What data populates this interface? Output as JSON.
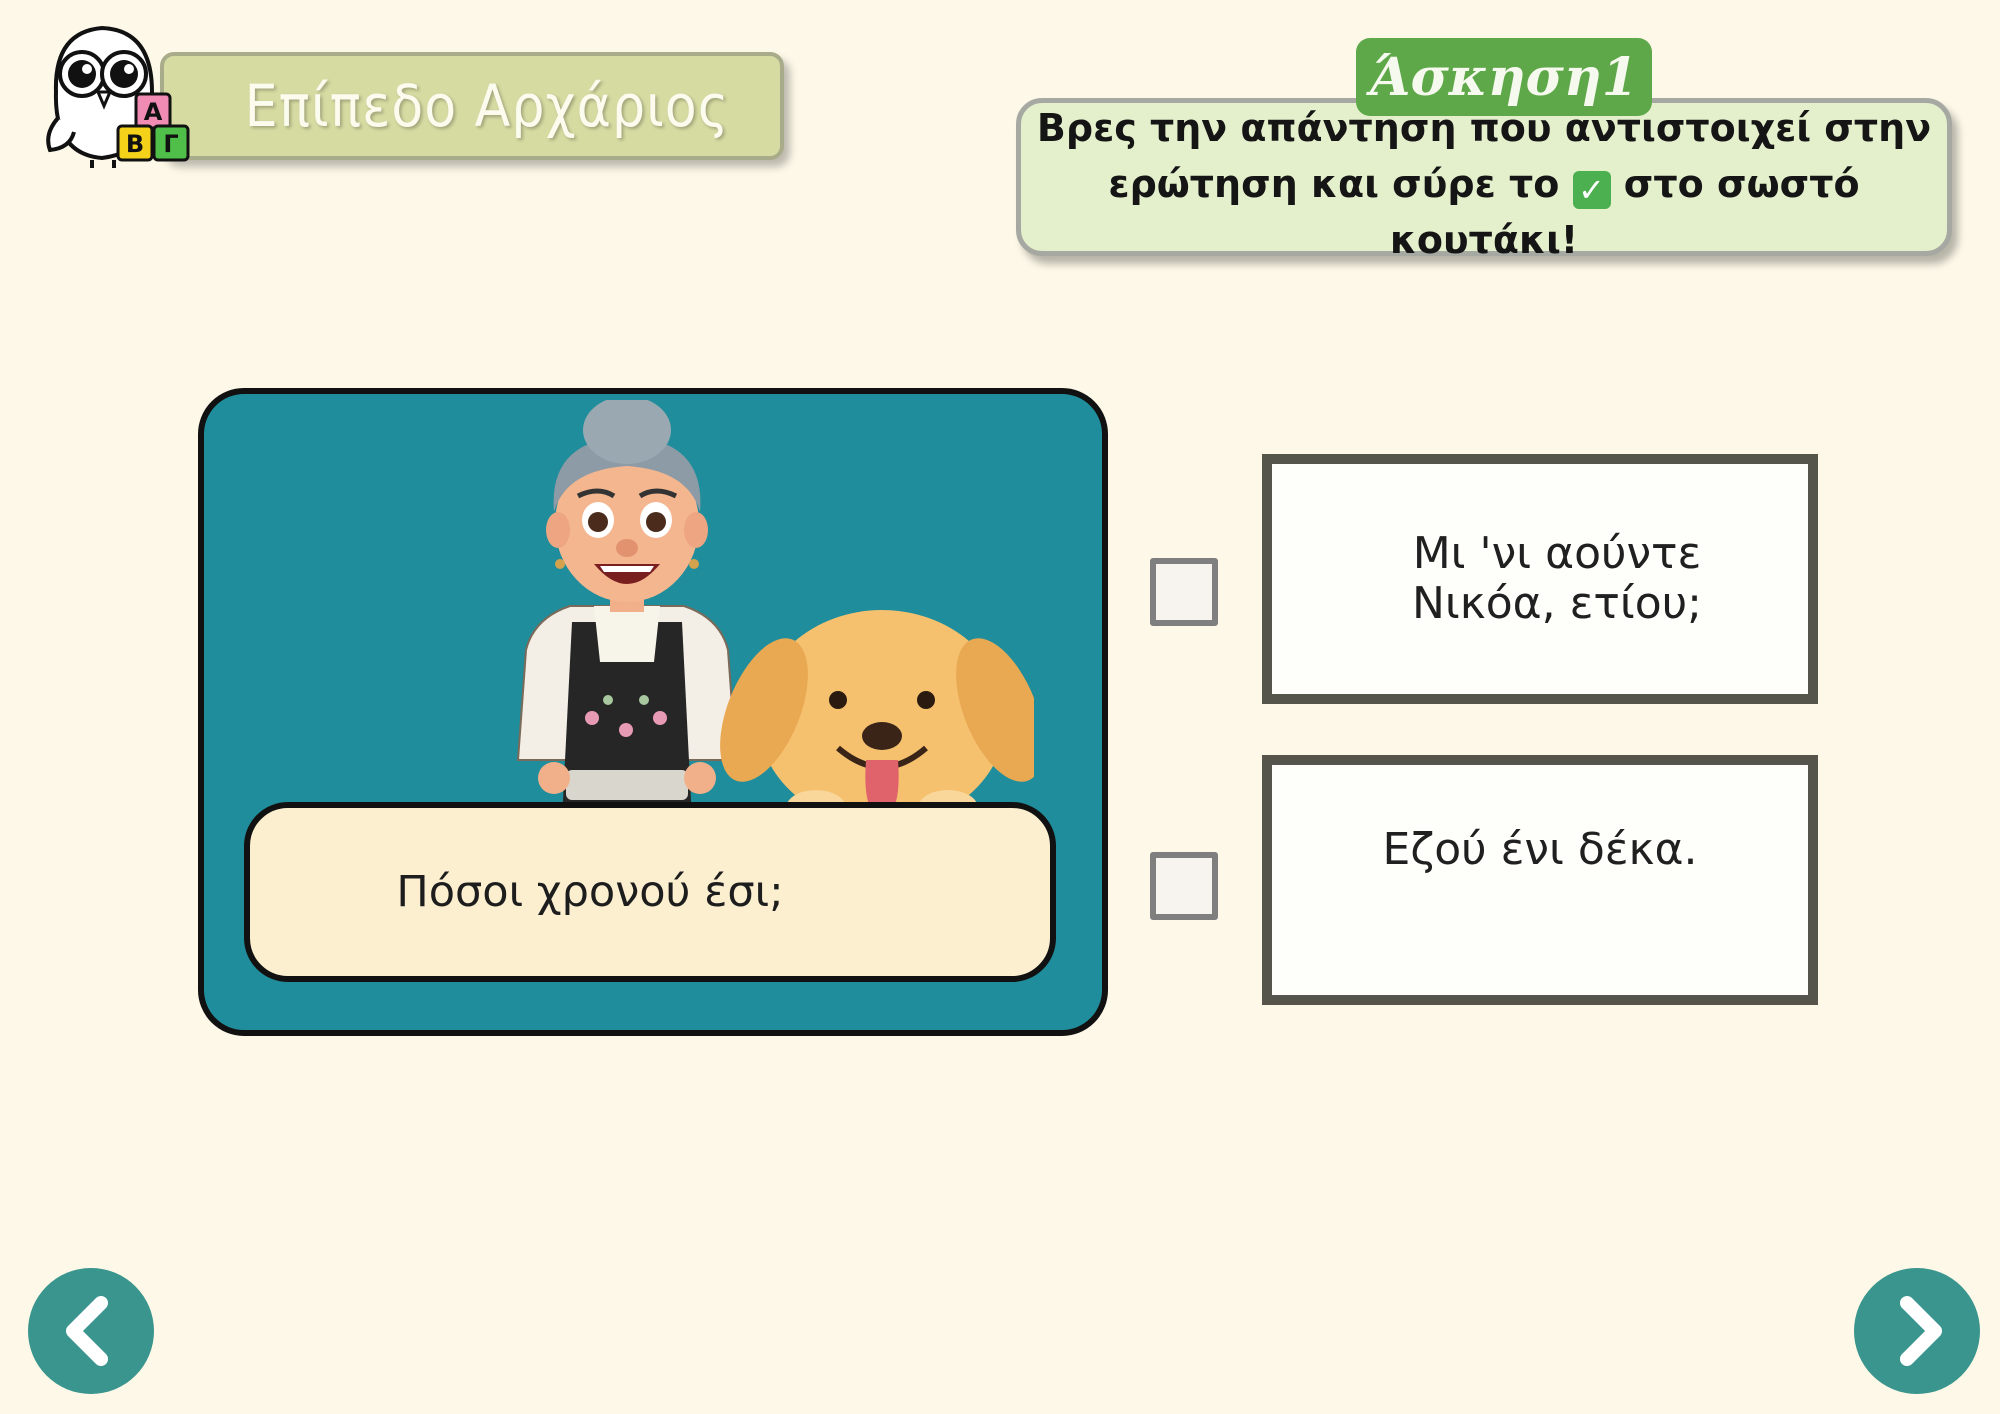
{
  "header": {
    "level_label": "Επίπεδο Αρχάριος",
    "logo_letters": [
      "Α",
      "Β",
      "Γ"
    ]
  },
  "exercise": {
    "tab_label": "Άσκηση1",
    "instruction_line1": "Βρες την απάντηση που αντιστοιχεί στην",
    "instruction_line2_before": "ερώτηση και σύρε το",
    "instruction_icon": "✓",
    "instruction_line2_after": "στο σωστό κουτάκι!"
  },
  "question": {
    "text": "Πόσοι χρονού έσι;",
    "illustration": "grandmother-and-dog"
  },
  "answers": [
    {
      "text": "Μι 'νι αούντε Νικόα, ετίου;",
      "checked": false
    },
    {
      "text": "Εζού ένι δέκα.",
      "checked": false
    }
  ],
  "nav": {
    "prev_icon": "chevron-left-icon",
    "next_icon": "chevron-right-icon"
  },
  "colors": {
    "background": "#fdf8e8",
    "card": "#1f8d9b",
    "nav": "#39958d",
    "tab": "#5ea849",
    "instruction_bg": "#e4efcc",
    "level_bg": "#d6dba2"
  }
}
